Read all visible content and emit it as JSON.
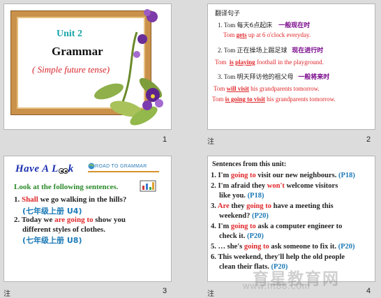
{
  "slide1": {
    "unit": "Unit 2",
    "title": "Grammar",
    "subtitle": "( Simple future tense)",
    "number": "1"
  },
  "slide2": {
    "heading": "翻译句子",
    "l1_num": "1. Tom",
    "l1_zh": "每天6点起床",
    "l1_tag": "一般现在时",
    "l2_a": "Tom",
    "l2_gets": "gets",
    "l2_b": "up at 6 o'clock everyday.",
    "l3_num": "2. Tom",
    "l3_zh": "正在操场上踢足球",
    "l3_tag": "现在进行时",
    "l4_a": "Tom",
    "l4_is": "is",
    "l4_playing": "playing",
    "l4_b": "football in the playground.",
    "l5_num": "3. Tom",
    "l5_zh": "明天拜访他的祖父母",
    "l5_tag": "一般将来时",
    "l6_a": "Tom",
    "l6_will": "will visit",
    "l6_b": "his grandparents tomorrow.",
    "l7_a": "Tom",
    "l7_going": "is going to visit",
    "l7_b": "his grandparents tomorrow.",
    "number": "2"
  },
  "slide3": {
    "have": "Have A L",
    "have_end": "k",
    "badge": "ROAD TO GRAMMAR",
    "look": "Look at the following sentences.",
    "s1_num": "1.",
    "s1_key": "Shall",
    "s1_rest": "we go walking in the hills?",
    "s1_ref": "(七年级上册 U4)",
    "s2_num": "2.",
    "s2_a": "Today we",
    "s2_key": "are going to",
    "s2_b": "show you",
    "s2_c": "different styles of clothes.",
    "s2_ref": "(七年级上册 U8)",
    "number": "3"
  },
  "slide4": {
    "heading": "Sentences from this unit:",
    "lines": [
      {
        "n": "1.",
        "a": "I'm",
        "k": "going to",
        "b": "visit our new neighbours.",
        "p": "(P18)"
      },
      {
        "n": "2.",
        "a": "I'm afraid they",
        "k": "won't",
        "b": "welcome visitors",
        "c": "like you.",
        "p": "(P18)"
      },
      {
        "n": "3.",
        "a": "",
        "k": "Are",
        "b": "they",
        "k2": "going to",
        "c": "have a meeting this",
        "d": "weekend?",
        "p": "(P20)"
      },
      {
        "n": "4.",
        "a": "I'm",
        "k": "going to",
        "b": "ask a computer engineer to",
        "c": "check it.",
        "p": "(P20)"
      },
      {
        "n": "5.",
        "a": "… she's",
        "k": "going to",
        "b": "ask someone to fix it.",
        "p": "(P20)"
      },
      {
        "n": "6.",
        "a": "This weekend, they'll help the old people",
        "c": "clean their flats.",
        "p": "(P20)"
      }
    ],
    "number": "4"
  },
  "comment_mark": "注",
  "watermark": "育星教育网",
  "watermark_url": "www.ht88.com"
}
